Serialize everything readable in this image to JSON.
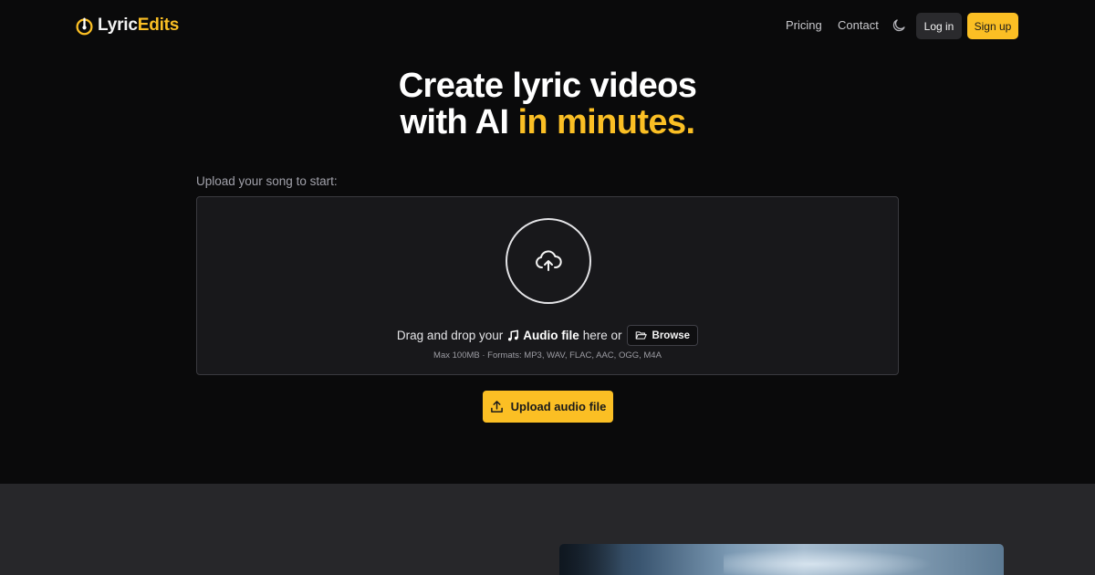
{
  "brand": {
    "name_part1": "Lyric",
    "name_part2": "Edits",
    "accent_color": "#fbbf24"
  },
  "nav": {
    "pricing": "Pricing",
    "contact": "Contact",
    "theme_icon": "moon-icon",
    "login": "Log in",
    "signup": "Sign up"
  },
  "hero": {
    "title_line1": "Create lyric videos",
    "title_line2_plain": "with AI",
    "title_line2_accent": "in minutes."
  },
  "upload": {
    "label": "Upload your song to start:",
    "drop_prefix": "Drag and drop your",
    "file_type": "Audio file",
    "drop_suffix": "here or",
    "browse": "Browse",
    "formats": "Max 100MB · Formats: MP3, WAV, FLAC, AAC, OGG, M4A",
    "button": "Upload audio file"
  }
}
